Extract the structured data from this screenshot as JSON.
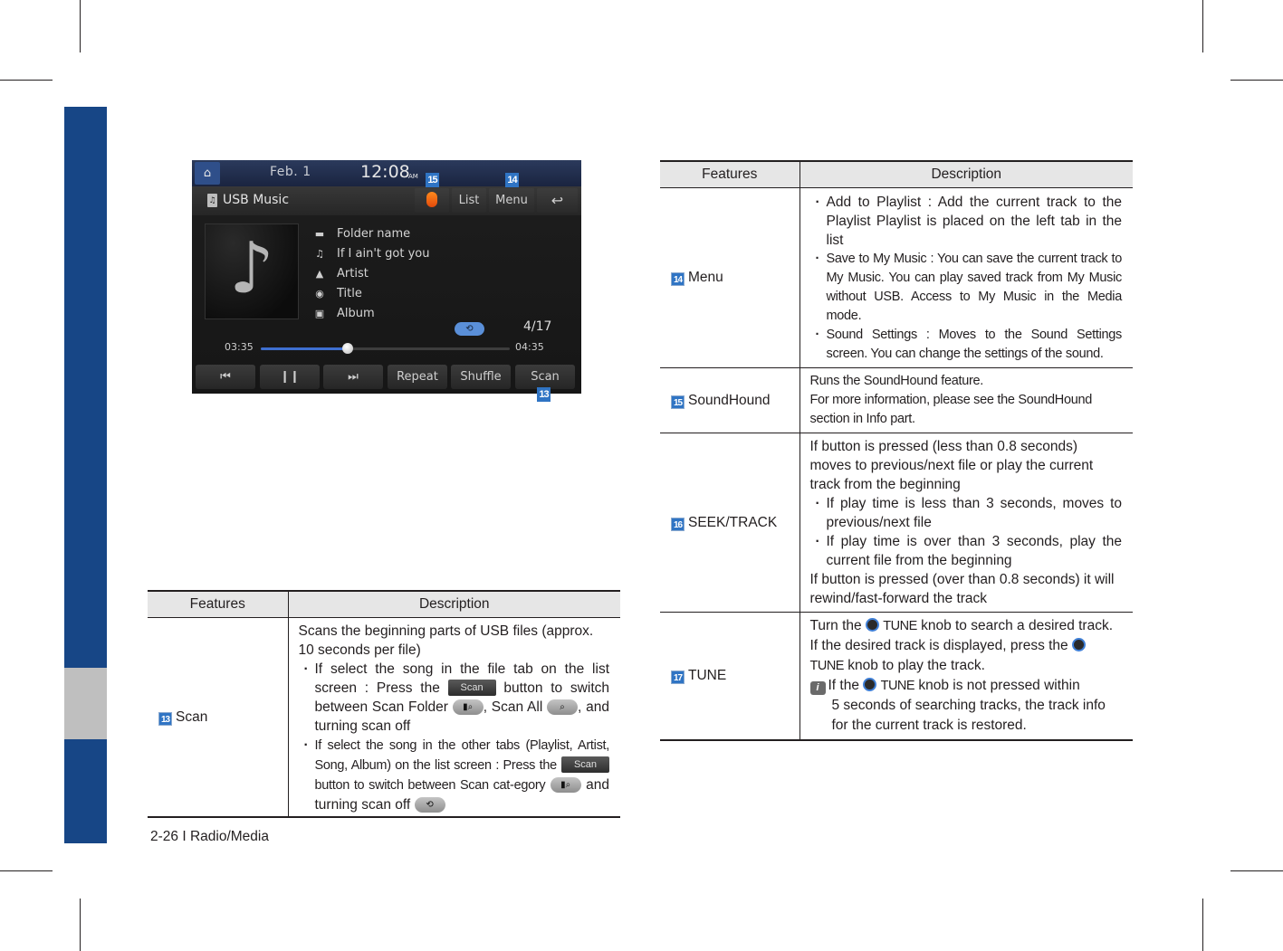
{
  "device_screen": {
    "date": "Feb.  1",
    "time": "12:08",
    "ampm": "AM",
    "title": "USB Music",
    "top_buttons": {
      "soundhound_icon": "soundhound-logo",
      "list": "List",
      "menu": "Menu",
      "back_icon": "↩"
    },
    "track_info": [
      {
        "icon": "folder-icon",
        "glyph": "▬",
        "text": "Folder name"
      },
      {
        "icon": "music-note-icon",
        "glyph": "♫",
        "text": "If I ain't got you"
      },
      {
        "icon": "person-icon",
        "glyph": "👤",
        "text": "Artist"
      },
      {
        "icon": "title-icon",
        "glyph": "◉",
        "text": "Title"
      },
      {
        "icon": "album-icon",
        "glyph": "▣",
        "text": "Album"
      }
    ],
    "album_art_glyph": "♪",
    "repeat_icon": "⟲",
    "track_counter": "4/17",
    "elapsed": "03:35",
    "total": "04:35",
    "progress_fraction": 0.35,
    "controls": [
      {
        "name": "previous-track-button",
        "label": "⏮"
      },
      {
        "name": "pause-button",
        "label": "❙❙"
      },
      {
        "name": "next-track-button",
        "label": "⏭"
      },
      {
        "name": "repeat-button",
        "label": "Repeat"
      },
      {
        "name": "shuffle-button",
        "label": "Shuffle"
      },
      {
        "name": "scan-button",
        "label": "Scan"
      }
    ],
    "markers": {
      "soundhound": "15",
      "menu": "14",
      "scan": "13"
    }
  },
  "left_table": {
    "headers": [
      "Features",
      "Description"
    ],
    "rows": [
      {
        "number": "13",
        "feature": "Scan",
        "intro": "Scans the beginning parts of USB files (approx. 10 seconds per file)",
        "bullet1_a": "If select the song in the file tab on the list screen : Press the",
        "scan_button": "Scan",
        "bullet1_b": "button to switch between Scan Folder",
        "bullet1_c": ", Scan All",
        "bullet1_d": ", and turning scan off",
        "bullet2_a": "If select the song in the other tabs (Playlist, Artist, Song, Album) on the list screen : Press the",
        "bullet2_b": "button to switch between Scan cat-egory",
        "bullet2_c": "and turning scan off"
      }
    ]
  },
  "right_table": {
    "headers": [
      "Features",
      "Description"
    ],
    "menu": {
      "number": "14",
      "feature": "Menu",
      "bullets": [
        "Add to Playlist : Add the current track to the Playlist Playlist is placed on the left tab in the list",
        "Save to My Music : You can save the current track to My Music. You can play saved track from My Music without USB.  Access to My Music in the Media mode.",
        "Sound Settings : Moves to the Sound Settings screen. You can change the settings of the sound."
      ]
    },
    "soundhound": {
      "number": "15",
      "feature": "SoundHound",
      "lines": [
        "Runs the SoundHound feature.",
        "For more information, please see the SoundHound section in Info part."
      ]
    },
    "seek": {
      "number": "16",
      "feature": "SEEK/TRACK",
      "intro": "If button is pressed (less than 0.8 seconds) moves to previous/next file or play the current track from the beginning",
      "bullets": [
        "If play time is less than 3 seconds, moves to previous/next file",
        "If play time is over than 3 seconds, play the current file from the beginning"
      ],
      "outro": "If button is pressed (over than 0.8 seconds) it will rewind/fast-forward the track"
    },
    "tune": {
      "number": "17",
      "feature": "TUNE",
      "knob_label": "TUNE",
      "p1_a": "Turn the",
      "p1_b": "knob to search a desired track. If the desired track is displayed, press the",
      "p1_c": "knob to play the track.",
      "note_a": "If the",
      "note_b": "knob is not pressed within",
      "note_c": "5 seconds of searching tracks, the track info for the current track is restored."
    }
  },
  "footer": "2-26 I Radio/Media",
  "colors": {
    "brand_blue": "#174686",
    "strip_gray": "#bfbfbf",
    "marker_blue": "#2f74c4",
    "progress_blue": "#3e6fd0"
  }
}
